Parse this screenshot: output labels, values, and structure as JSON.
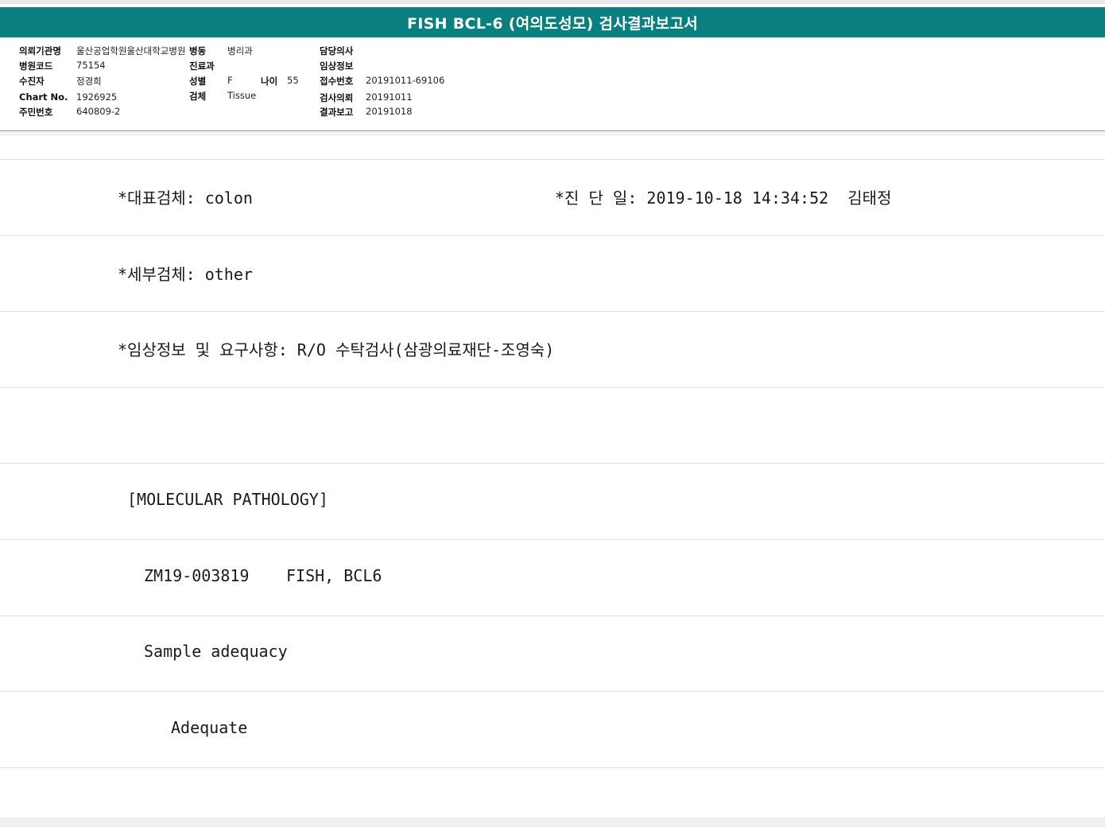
{
  "title": "FISH BCL-6 (여의도성모) 검사결과보고서",
  "header": {
    "institution_label": "의뢰기관명",
    "institution_value": "울산공업학원울산대학교병원",
    "ward_label": "병동",
    "ward_value": "병리과",
    "attending_label": "담당의사",
    "attending_value": "",
    "hospital_code_label": "병원코드",
    "hospital_code_value": "75154",
    "department_label": "진료과",
    "department_value": "",
    "clinical_info_label": "임상정보",
    "clinical_info_value": "",
    "patient_label": "수진자",
    "patient_value": "정경희",
    "sex_label": "성별",
    "sex_value": "F",
    "age_label": "나이",
    "age_value": "55",
    "receipt_label": "접수번호",
    "receipt_value": "20191011-69106",
    "chart_label": "Chart No.",
    "chart_value": "1926925",
    "specimen_label": "검체",
    "specimen_value": "Tissue",
    "request_label": "검사의뢰",
    "request_value": "20191011",
    "resident_label": "주민번호",
    "resident_value": "640809-2",
    "report_label": "결과보고",
    "report_value": "20191018"
  },
  "body": {
    "rep_specimen": "*대표검체: colon",
    "diagnosis_date": "*진 단 일: 2019-10-18 14:34:52  김태정",
    "sub_specimen": "*세부검체: other",
    "clinical_request": "*임상정보 및 요구사항: R/O 수탁검사(삼광의료재단-조영숙)",
    "section": "[MOLECULAR PATHOLOGY]",
    "test_id": "ZM19-003819",
    "test_name": "FISH, BCL6",
    "adequacy_label": "Sample adequacy",
    "adequacy_value": "Adequate"
  }
}
